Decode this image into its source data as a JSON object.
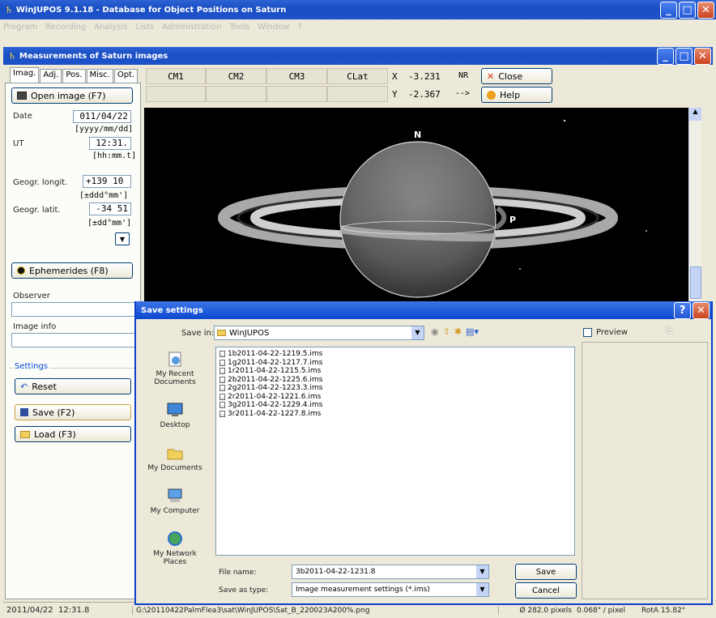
{
  "app": {
    "title": "WinJUPOS 9.1.18 - Database for Object Positions on Saturn",
    "menu": [
      "Program",
      "Recording",
      "Analysis",
      "Lists",
      "Administration",
      "Tools",
      "Window",
      "?"
    ]
  },
  "inner_window": {
    "title": "Measurements of Saturn images",
    "tabs": [
      "Imag.",
      "Adj.",
      "Pos.",
      "Misc.",
      "Opt."
    ],
    "open_image_label": "Open image (F7)",
    "date_label": "Date",
    "date_value": "011/04/22",
    "date_format": "[yyyy/mm/dd]",
    "ut_label": "UT",
    "ut_value": "12:31.",
    "ut_format": "[hh:mm.t]",
    "longit_label": "Geogr. longit.",
    "longit_value": "+139 10",
    "longit_format": "[±ddd°mm']",
    "latit_label": "Geogr. latit.",
    "latit_value": "-34 51",
    "latit_format": "[±dd°mm']",
    "ephemerides_label": "Ephemerides (F8)",
    "observer_label": "Observer",
    "image_info_label": "Image info",
    "settings_label": "Settings",
    "reset_label": "Reset",
    "save_label": "Save (F2)",
    "load_label": "Load (F3)",
    "header": {
      "cm1": "CM1",
      "cm2": "CM2",
      "cm3": "CM3",
      "clat": "CLat",
      "x_label": "X",
      "x_value": "-3.231",
      "x_suffix": "NR",
      "y_label": "Y",
      "y_value": "-2.367",
      "y_suffix": "-->",
      "close_label": "Close",
      "help_label": "Help"
    },
    "image": {
      "north_marker": "N",
      "p_marker": "P"
    }
  },
  "dialog": {
    "title": "Save settings",
    "save_in_label": "Save in:",
    "save_in_value": "WinJUPOS",
    "preview_label": "Preview",
    "places": [
      "My Recent Documents",
      "Desktop",
      "My Documents",
      "My Computer",
      "My Network Places"
    ],
    "files": [
      "1b2011-04-22-1219.5.ims",
      "1g2011-04-22-1217.7.ims",
      "1r2011-04-22-1215.5.ims",
      "2b2011-04-22-1225.6.ims",
      "2g2011-04-22-1223.3.ims",
      "2r2011-04-22-1221.6.ims",
      "3g2011-04-22-1229.4.ims",
      "3r2011-04-22-1227.8.ims"
    ],
    "file_name_label": "File name:",
    "file_name_value": "3b2011-04-22-1231.8",
    "save_type_label": "Save as type:",
    "save_type_value": "Image measurement settings (*.ims)",
    "save_button": "Save",
    "cancel_button": "Cancel"
  },
  "statusbar": {
    "datetime": "2011/04/22  12:31.8",
    "path": "G:\\20110422PalmFlea3\\sat\\WinJUPOS\\Sat_B_220023A200%.png",
    "diameter": "Ø 282.0 pixels",
    "scale": "0.068\" / pixel",
    "rota": "RotA 15.82°"
  },
  "colors": {
    "title_blue": "#1d52c9",
    "xp_face": "#ece9d8",
    "close_red": "#c9431f"
  }
}
